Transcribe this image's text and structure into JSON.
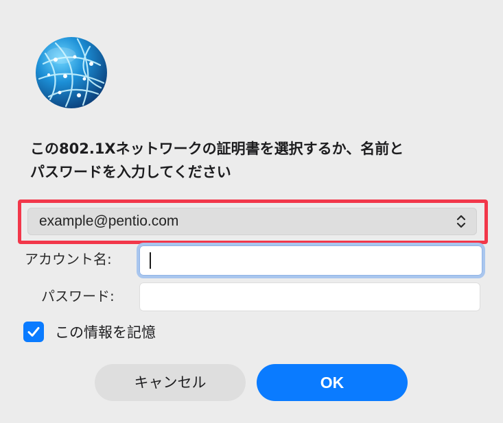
{
  "dialog": {
    "icon": "network-globe-icon",
    "message_line1": "この802.1Xネットワークの証明書を選択するか、名前と",
    "message_line2": "パスワードを入力してください"
  },
  "certificate_select": {
    "selected_value": "example@pentio.com",
    "icon": "up-down-chevron-icon"
  },
  "form": {
    "account_label": "アカウント名:",
    "account_value": "",
    "password_label": "パスワード:",
    "password_value": ""
  },
  "remember": {
    "label": "この情報を記憶",
    "checked": true
  },
  "buttons": {
    "cancel_label": "キャンセル",
    "ok_label": "OK"
  },
  "colors": {
    "accent": "#0a7bff",
    "highlight": "#f2374a",
    "background": "#ececec"
  }
}
